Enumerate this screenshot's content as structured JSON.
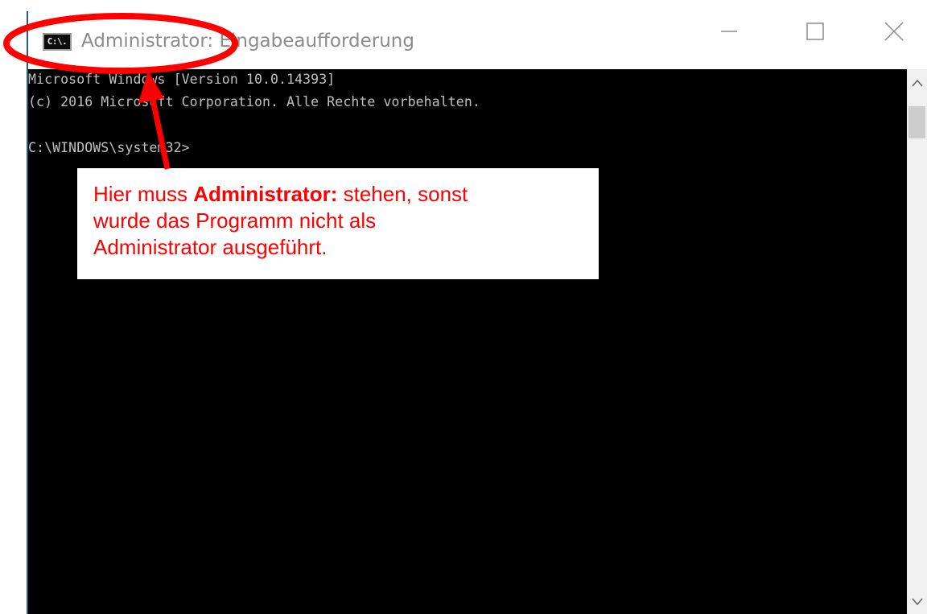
{
  "window": {
    "title": "Administrator: Eingabeaufforderung",
    "icon": "cmd-icon",
    "icon_text": "C:\\."
  },
  "controls": {
    "minimize": "minimize-icon",
    "maximize": "maximize-icon",
    "close": "close-icon"
  },
  "console": {
    "lines": [
      "Microsoft Windows [Version 10.0.14393]",
      "(c) 2016 Microsoft Corporation. Alle Rechte vorbehalten.",
      "",
      "C:\\WINDOWS\\system32>"
    ]
  },
  "annotation": {
    "text_before": "Hier muss ",
    "text_bold": "Administrator:",
    "text_after_line1": " stehen, sonst",
    "line2": "wurde das Programm nicht als",
    "line3": "Administrator ausgeführt.",
    "color": "#ff0000"
  },
  "colors": {
    "console_bg": "#000000",
    "console_text": "#c0c0c0",
    "title_text": "#8b8b8b",
    "accent_border": "#2b5797",
    "annotation_red": "#ff0000"
  }
}
